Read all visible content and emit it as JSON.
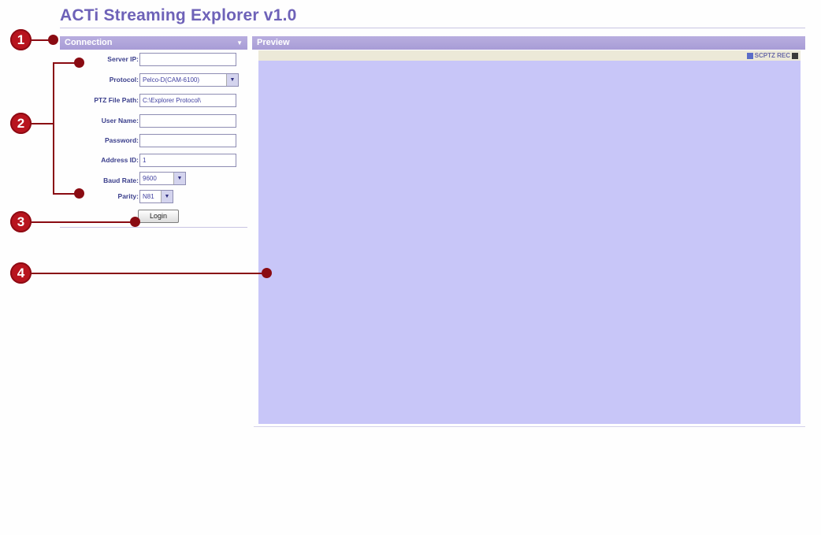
{
  "app": {
    "title": "ACTi Streaming Explorer v1.0"
  },
  "connection_panel": {
    "header": "Connection",
    "fields": {
      "server_ip": {
        "label": "Server IP:",
        "value": ""
      },
      "protocol": {
        "label": "Protocol:",
        "value": "Pelco-D(CAM-6100)"
      },
      "ptz_file_path": {
        "label": "PTZ File Path:",
        "value": "C:\\Explorer Protocol\\"
      },
      "user_name": {
        "label": "User Name:",
        "value": ""
      },
      "password": {
        "label": "Password:",
        "value": ""
      },
      "address_id": {
        "label": "Address ID:",
        "value": "1"
      },
      "baud_rate": {
        "label": "Baud Rate:",
        "value": "9600"
      },
      "parity": {
        "label": "Parity:",
        "value": "N81"
      }
    },
    "login_label": "Login"
  },
  "preview_panel": {
    "header": "Preview",
    "toolbar_text": "SCPTZ REC"
  },
  "callouts": [
    "1",
    "2",
    "3",
    "4"
  ],
  "colors": {
    "title": "#6e62b8",
    "panel_header": "#a89cd6",
    "label_text": "#3b3f8c",
    "video_background": "#c8c6f8",
    "callout": "#b8141e"
  }
}
